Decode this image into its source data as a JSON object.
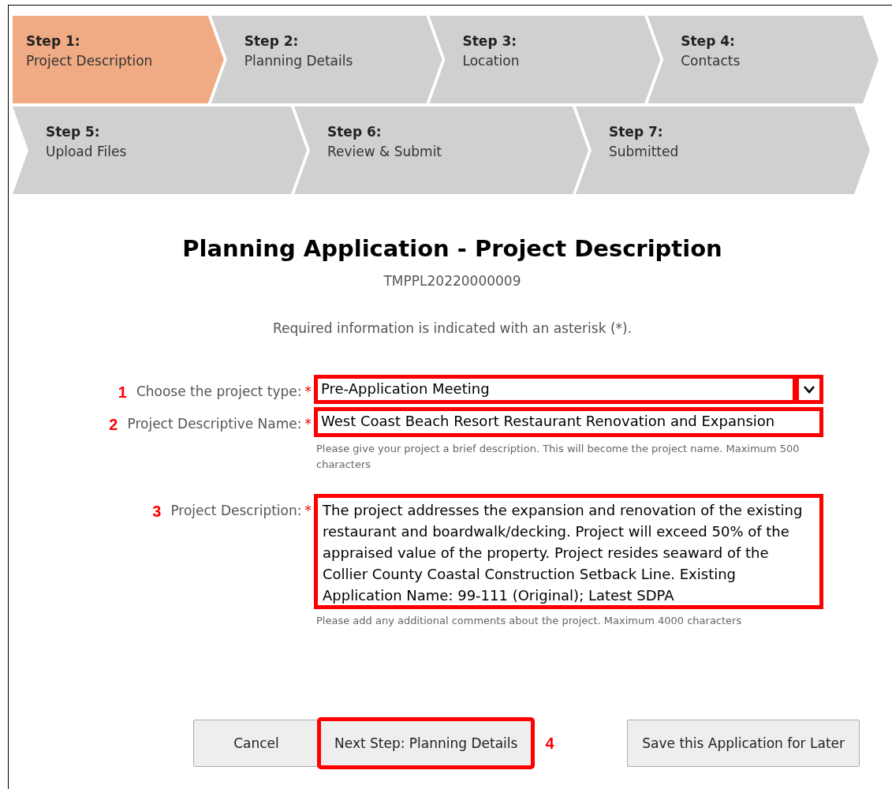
{
  "steps": [
    [
      {
        "label": "Step 1:",
        "name": "Project Description",
        "selected": true
      },
      {
        "label": "Step 2:",
        "name": "Planning Details",
        "selected": false
      },
      {
        "label": "Step 3:",
        "name": "Location",
        "selected": false
      },
      {
        "label": "Step 4:",
        "name": "Contacts",
        "selected": false
      }
    ],
    [
      {
        "label": "Step 5:",
        "name": "Upload Files",
        "selected": false
      },
      {
        "label": "Step 6:",
        "name": "Review & Submit",
        "selected": false
      },
      {
        "label": "Step 7:",
        "name": "Submitted",
        "selected": false
      }
    ]
  ],
  "title": "Planning Application - Project Description",
  "application_id": "TMPPL20220000009",
  "required_note": "Required information is indicated with an asterisk (*).",
  "fields": [
    {
      "kind": "select",
      "callout": "1",
      "highlighted": true,
      "label": "Choose the project type:",
      "required_mark": "*",
      "value": "Pre-Application Meeting"
    },
    {
      "kind": "text",
      "callout": "2",
      "highlighted": true,
      "label": "Project Descriptive Name:",
      "required_mark": "*",
      "value": "West Coast Beach Resort Restaurant Renovation and Expansion",
      "hint": "Please give your project a brief description. This will become the project name. Maximum 500 characters"
    },
    {
      "kind": "textarea",
      "callout": "3",
      "highlighted": true,
      "label": "Project Description:",
      "required_mark": "*",
      "value": "The project addresses the expansion and renovation of the existing restaurant and boardwalk/decking. Project will exceed 50% of the appraised value of the property. Project resides seaward of the Collier County Coastal Construction Setback Line. Existing Application Name: 99-111 (Original); Latest SDPA",
      "hint": "Please add any additional comments about the project. Maximum 4000 characters"
    }
  ],
  "buttons": [
    {
      "label": "Cancel",
      "highlighted": false
    },
    {
      "label": "Next Step: Planning Details",
      "highlighted": true,
      "callout": "4"
    },
    {
      "label": "Save this Application for Later",
      "highlighted": false
    }
  ]
}
